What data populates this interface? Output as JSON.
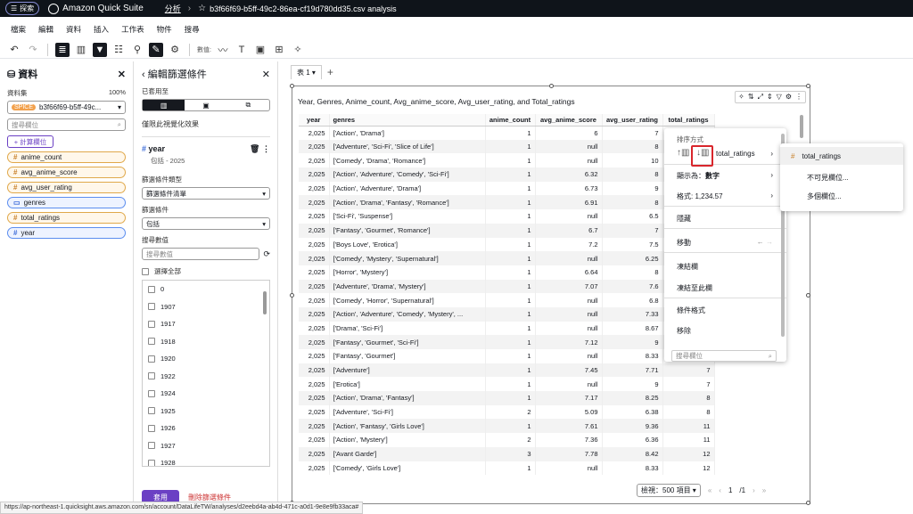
{
  "topbar": {
    "explore": "探索",
    "brand": "Amazon Quick Suite",
    "crumb": "分析",
    "file": "b3f66f69-b5ff-49c2-86ea-cf19d780dd35.csv analysis"
  },
  "menubar": [
    "檔案",
    "編輯",
    "資料",
    "插入",
    "工作表",
    "物件",
    "搜尋"
  ],
  "toolbar": {
    "label": "數值:"
  },
  "datapane": {
    "title": "資料",
    "dataset_label": "資料集",
    "dataset_pct": "100%",
    "spice": "SPICE",
    "dataset_name": "b3f66f69-b5ff-49c...",
    "search_placeholder": "搜尋欄位",
    "add_calc": "+ 計算欄位",
    "fields": [
      {
        "name": "anime_count",
        "kind": "measure"
      },
      {
        "name": "avg_anime_score",
        "kind": "measure"
      },
      {
        "name": "avg_user_rating",
        "kind": "measure"
      },
      {
        "name": "genres",
        "kind": "dimension"
      },
      {
        "name": "total_ratings",
        "kind": "measure"
      },
      {
        "name": "year",
        "kind": "dimension"
      }
    ]
  },
  "filterpane": {
    "title": "編輯篩選條件",
    "applied_label": "已套用至",
    "scope_text": "僅限此視覺化效果",
    "filter_name": "year",
    "filter_sub": "包括 - 2025",
    "type_label": "篩選條件類型",
    "type_value": "篩選條件清單",
    "cond_label": "篩選條件",
    "cond_value": "包括",
    "search_label": "搜尋數值",
    "search_placeholder": "搜尋數值",
    "select_all": "選擇全部",
    "values": [
      "0",
      "1907",
      "1917",
      "1918",
      "1920",
      "1922",
      "1924",
      "1925",
      "1926",
      "1927",
      "1928"
    ],
    "apply": "套用",
    "delete": "刪除篩選條件"
  },
  "sheet": {
    "tab": "表 1"
  },
  "visual": {
    "title": "Year, Genres, Anime_count, Avg_anime_score, Avg_user_rating, and Total_ratings",
    "columns": [
      "year",
      "genres",
      "anime_count",
      "avg_anime_score",
      "avg_user_rating",
      "total_ratings"
    ],
    "rows": [
      [
        "2,025",
        "['Action', 'Drama']",
        "1",
        "6",
        "7",
        ""
      ],
      [
        "2,025",
        "['Adventure', 'Sci-Fi', 'Slice of Life']",
        "1",
        "null",
        "8",
        ""
      ],
      [
        "2,025",
        "['Comedy', 'Drama', 'Romance']",
        "1",
        "null",
        "10",
        ""
      ],
      [
        "2,025",
        "['Action', 'Adventure', 'Comedy', 'Sci-Fi']",
        "1",
        "6.32",
        "8",
        ""
      ],
      [
        "2,025",
        "['Action', 'Adventure', 'Drama']",
        "1",
        "6.73",
        "9",
        ""
      ],
      [
        "2,025",
        "['Action', 'Drama', 'Fantasy', 'Romance']",
        "1",
        "6.91",
        "8",
        ""
      ],
      [
        "2,025",
        "['Sci-Fi', 'Suspense']",
        "1",
        "null",
        "6.5",
        ""
      ],
      [
        "2,025",
        "['Fantasy', 'Gourmet', 'Romance']",
        "1",
        "6.7",
        "7",
        ""
      ],
      [
        "2,025",
        "['Boys Love', 'Erotica']",
        "1",
        "7.2",
        "7.5",
        ""
      ],
      [
        "2,025",
        "['Comedy', 'Mystery', 'Supernatural']",
        "1",
        "null",
        "6.25",
        ""
      ],
      [
        "2,025",
        "['Horror', 'Mystery']",
        "1",
        "6.64",
        "8",
        ""
      ],
      [
        "2,025",
        "['Adventure', 'Drama', 'Mystery']",
        "1",
        "7.07",
        "7.6",
        ""
      ],
      [
        "2,025",
        "['Comedy', 'Horror', 'Supernatural']",
        "1",
        "null",
        "6.8",
        ""
      ],
      [
        "2,025",
        "['Action', 'Adventure', 'Comedy', 'Mystery', ...",
        "1",
        "null",
        "7.33",
        ""
      ],
      [
        "2,025",
        "['Drama', 'Sci-Fi']",
        "1",
        "null",
        "8.67",
        ""
      ],
      [
        "2,025",
        "['Fantasy', 'Gourmet', 'Sci-Fi']",
        "1",
        "7.12",
        "9",
        ""
      ],
      [
        "2,025",
        "['Fantasy', 'Gourmet']",
        "1",
        "null",
        "8.33",
        ""
      ],
      [
        "2,025",
        "['Adventure']",
        "1",
        "7.45",
        "7.71",
        "7"
      ],
      [
        "2,025",
        "['Erotica']",
        "1",
        "null",
        "9",
        "7"
      ],
      [
        "2,025",
        "['Action', 'Drama', 'Fantasy']",
        "1",
        "7.17",
        "8.25",
        "8"
      ],
      [
        "2,025",
        "['Adventure', 'Sci-Fi']",
        "2",
        "5.09",
        "6.38",
        "8"
      ],
      [
        "2,025",
        "['Action', 'Fantasy', 'Girls Love']",
        "1",
        "7.61",
        "9.36",
        "11"
      ],
      [
        "2,025",
        "['Action', 'Mystery']",
        "2",
        "7.36",
        "6.36",
        "11"
      ],
      [
        "2,025",
        "['Avant Garde']",
        "3",
        "7.78",
        "8.42",
        "12"
      ],
      [
        "2,025",
        "['Comedy', 'Girls Love']",
        "1",
        "null",
        "8.33",
        "12"
      ]
    ],
    "pager_rows": "檢視：500 項目",
    "pager_page": "1",
    "pager_total": "/1"
  },
  "context_menu": {
    "sort_label": "排序方式",
    "sort_field": "total_ratings",
    "display_as": "顯示為：",
    "display_as_value": "數字",
    "format": "格式: 1,234.57",
    "hide": "隱藏",
    "move": "移動",
    "freeze_col": "凍結欄",
    "freeze_to": "凍結至此欄",
    "cond_format": "條件格式",
    "remove": "移除",
    "search_placeholder": "搜尋欄位"
  },
  "submenu": {
    "items": [
      "total_ratings",
      "不可見欄位...",
      "多個欄位..."
    ]
  },
  "statusbar": {
    "url": "https://ap-northeast-1.quicksight.aws.amazon.com/sn/account/DataLifeTW/analyses/d2eebd4a-ab4d-471c-a0d1-9e8e9fb33aca#"
  },
  "colors": {
    "accent": "#6b40c4",
    "highlight": "#d9262c",
    "measure": "#e0a84a",
    "dimension": "#5b8def"
  }
}
